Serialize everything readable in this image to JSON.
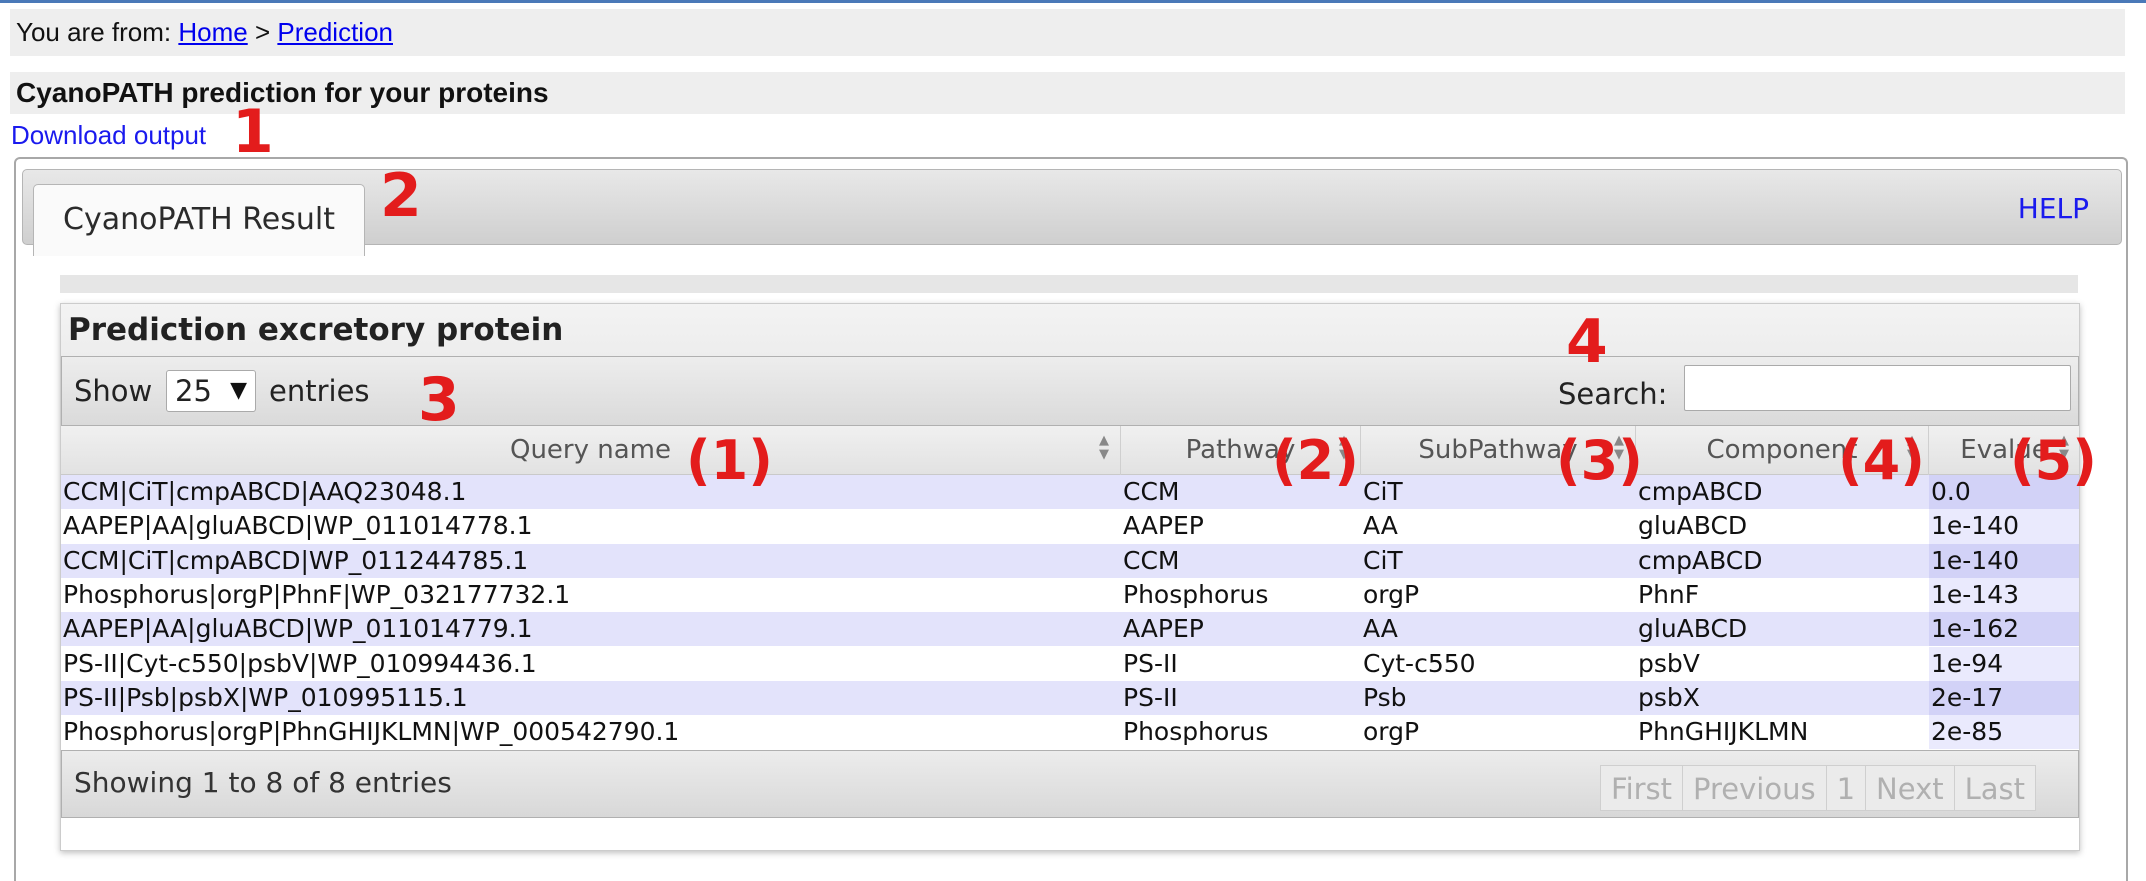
{
  "breadcrumb": {
    "prefix": "You are from:",
    "home": "Home",
    "separator": ">",
    "current": "Prediction"
  },
  "page_title": "CyanoPATH prediction for your proteins",
  "download_label": "Download output",
  "tabs": [
    {
      "label": "CyanoPATH Result",
      "active": true
    }
  ],
  "help_label": "HELP",
  "panel": {
    "title": "Prediction excretory protein",
    "length": {
      "show_label": "Show",
      "value": "25",
      "entries_label": "entries"
    },
    "search": {
      "label": "Search:",
      "value": ""
    },
    "columns": [
      "Query name",
      "Pathway",
      "SubPathway",
      "Component",
      "Evalue"
    ],
    "rows": [
      [
        "CCM|CiT|cmpABCD|AAQ23048.1",
        "CCM",
        "CiT",
        "cmpABCD",
        "0.0"
      ],
      [
        "AAPEP|AA|gluABCD|WP_011014778.1",
        "AAPEP",
        "AA",
        "gluABCD",
        "1e-140"
      ],
      [
        "CCM|CiT|cmpABCD|WP_011244785.1",
        "CCM",
        "CiT",
        "cmpABCD",
        "1e-140"
      ],
      [
        "Phosphorus|orgP|PhnF|WP_032177732.1",
        "Phosphorus",
        "orgP",
        "PhnF",
        "1e-143"
      ],
      [
        "AAPEP|AA|gluABCD|WP_011014779.1",
        "AAPEP",
        "AA",
        "gluABCD",
        "1e-162"
      ],
      [
        "PS-II|Cyt-c550|psbV|WP_010994436.1",
        "PS-II",
        "Cyt-c550",
        "psbV",
        "1e-94"
      ],
      [
        "PS-II|Psb|psbX|WP_010995115.1",
        "PS-II",
        "Psb",
        "psbX",
        "2e-17"
      ],
      [
        "Phosphorus|orgP|PhnGHIJKLMN|WP_000542790.1",
        "Phosphorus",
        "orgP",
        "PhnGHIJKLMN",
        "2e-85"
      ]
    ],
    "info": "Showing 1 to 8 of 8 entries",
    "pagination": [
      "First",
      "Previous",
      "1",
      "Next",
      "Last"
    ]
  },
  "annotations": [
    "1",
    "2",
    "3",
    "4",
    "(1)",
    "(2)",
    "(3)",
    "(4)",
    "(5)"
  ],
  "colors": {
    "annotation": "#e31c1c",
    "link": "#1a1aee",
    "row_odd": "#e3e3fb",
    "row_sorted": "#d2d2f7"
  }
}
